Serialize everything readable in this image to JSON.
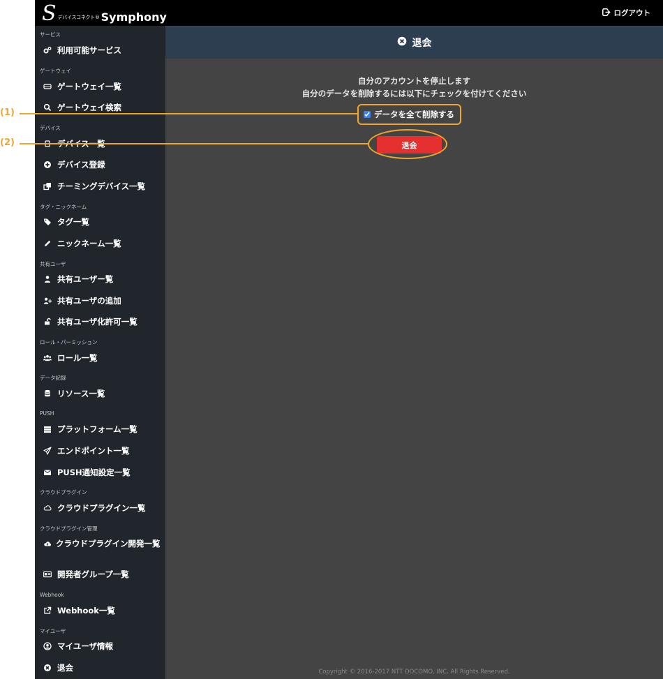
{
  "header_bar": {
    "logo": {
      "mark": "S",
      "sub_text": "デバイスコネクト®",
      "product": "Symphony"
    },
    "logout_label": "ログアウト",
    "logout_icon": "sign-out-icon"
  },
  "sidebar": {
    "sections": [
      {
        "title": "サービス",
        "items": [
          {
            "label": "利用可能サービス",
            "icon": "cogs-icon"
          }
        ]
      },
      {
        "title": "ゲートウェイ",
        "items": [
          {
            "label": "ゲートウェイ一覧",
            "icon": "hdd-icon"
          },
          {
            "label": "ゲートウェイ検索",
            "icon": "search-icon"
          }
        ]
      },
      {
        "title": "デバイス",
        "items": [
          {
            "label": "デバイス一覧",
            "icon": "device-icon"
          },
          {
            "label": "デバイス登録",
            "icon": "plus-circle-icon"
          },
          {
            "label": "チーミングデバイス一覧",
            "icon": "clone-icon"
          }
        ]
      },
      {
        "title": "タグ・ニックネーム",
        "items": [
          {
            "label": "タグ一覧",
            "icon": "tags-icon"
          },
          {
            "label": "ニックネーム一覧",
            "icon": "pencil-icon"
          }
        ]
      },
      {
        "title": "共有ユーザ",
        "items": [
          {
            "label": "共有ユーザー覧",
            "icon": "user-icon"
          },
          {
            "label": "共有ユーザの追加",
            "icon": "user-plus-icon"
          },
          {
            "label": "共有ユーザ化許可一覧",
            "icon": "unlock-icon"
          }
        ]
      },
      {
        "title": "ロール・パーミッション",
        "items": [
          {
            "label": "ロール一覧",
            "icon": "users-icon"
          }
        ]
      },
      {
        "title": "データ記録",
        "items": [
          {
            "label": "リソース一覧",
            "icon": "database-icon"
          }
        ]
      },
      {
        "title": "PUSH",
        "items": [
          {
            "label": "プラットフォーム一覧",
            "icon": "server-icon"
          },
          {
            "label": "エンドポイント一覧",
            "icon": "paper-plane-icon"
          },
          {
            "label": "PUSH通知設定一覧",
            "icon": "envelope-icon"
          }
        ]
      },
      {
        "title": "クラウドプラグイン",
        "items": [
          {
            "label": "クラウドプラグイン一覧",
            "icon": "cloud-icon"
          }
        ]
      },
      {
        "title": "クラウドプラグイン管理",
        "items": [
          {
            "label": "クラウドプラグイン開発一覧",
            "icon": "cloud-upload-icon"
          },
          {
            "label": "開発者グループ一覧",
            "icon": "id-card-icon"
          }
        ]
      },
      {
        "title": "Webhook",
        "items": [
          {
            "label": "Webhook一覧",
            "icon": "external-link-icon"
          }
        ]
      },
      {
        "title": "マイユーザ",
        "items": [
          {
            "label": "マイユーザ情報",
            "icon": "user-circle-icon"
          },
          {
            "label": "退会",
            "icon": "times-circle-icon"
          }
        ]
      }
    ]
  },
  "page": {
    "title": "退会",
    "title_icon": "times-circle-icon",
    "message_line1": "自分のアカウントを停止します",
    "message_line2": "自分のデータを削除するには以下にチェックを付けてください",
    "checkbox_label": "データを全て削除する",
    "checkbox_checked": true,
    "button_label": "退会",
    "copyright": "Copyright © 2016-2017 NTT DOCOMO, INC. All Rights Reserved."
  },
  "annotations": {
    "callout_1": "(1)",
    "callout_2": "(2)",
    "color": "#f0a72a"
  },
  "colors": {
    "topbar": "#000000",
    "sidebar": "#21262d",
    "header": "#2c3e50",
    "content": "#444444",
    "button": "#e53030"
  }
}
